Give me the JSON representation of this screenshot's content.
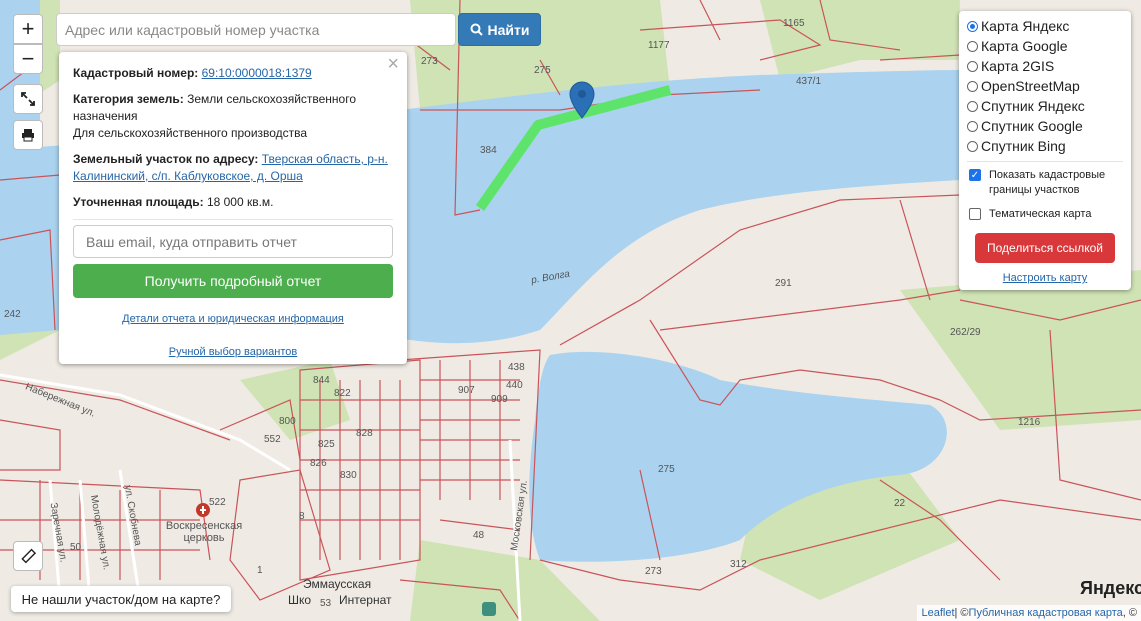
{
  "controls": {
    "zoom_in_label": "+",
    "zoom_out_label": "−",
    "fullscreen_icon": "expand-icon",
    "print_icon": "print-icon",
    "ruler_icon": "ruler-icon"
  },
  "search": {
    "placeholder": "Адрес или кадастровый номер участка",
    "button_label": "Найти"
  },
  "popup": {
    "cadastral_label": "Кадастровый номер:",
    "cadastral_value": "69:10:0000018:1379",
    "category_label": "Категория земель:",
    "category_value": "Земли сельскохозяйственного назначения",
    "usage_value": "Для сельскохозяйственного производства",
    "address_label": "Земельный участок по адресу:",
    "address_value": "Тверская область, р-н. Калининский, с/п. Каблуковское, д. Орша",
    "area_label": "Уточненная площадь:",
    "area_value": "18 000 кв.м.",
    "email_placeholder": "Ваш email, куда отправить отчет",
    "report_button": "Получить подробный отчет",
    "details_link": "Детали отчета и юридическая информация",
    "manual_link": "Ручной выбор вариантов"
  },
  "layers": {
    "options": [
      {
        "label": "Карта Яндекс",
        "selected": true
      },
      {
        "label": "Карта Google",
        "selected": false
      },
      {
        "label": "Карта 2GIS",
        "selected": false
      },
      {
        "label": "OpenStreetMap",
        "selected": false
      },
      {
        "label": "Спутник Яндекс",
        "selected": false
      },
      {
        "label": "Спутник Google",
        "selected": false
      },
      {
        "label": "Спутник Bing",
        "selected": false
      }
    ],
    "show_boundaries_label": "Показать кадастровые границы участков",
    "show_boundaries_checked": true,
    "thematic_label": "Тематическая карта",
    "thematic_checked": false,
    "share_button": "Поделиться ссылкой",
    "tune_link": "Настроить карту"
  },
  "not_found_button": "Не нашли участок/дом на карте?",
  "attribution": {
    "leaflet": "Leaflet",
    "sep": " | © ",
    "pkk": "Публичная кадастровая карта",
    "tail": ", ©"
  },
  "yandex_logo": "Яндекс",
  "map_labels": {
    "river": "р. Волга",
    "n1165": "1165",
    "n1177": "1177",
    "n273a": "273",
    "n275a": "275",
    "n437": "437/1",
    "n384": "384",
    "n242": "242",
    "n291": "291",
    "n262": "262/29",
    "n1216": "1216",
    "n275b": "275",
    "n22": "22",
    "n312": "312",
    "n273b": "273",
    "n438": "438",
    "n440": "440",
    "n907": "907",
    "n909": "909",
    "n844": "844",
    "n822": "822",
    "n800": "800",
    "n552": "552",
    "n825": "825",
    "n826": "826",
    "n828": "828",
    "n830": "830",
    "n8": "8",
    "n48": "48",
    "n1": "1",
    "n522": "522",
    "n50": "50",
    "n53": "53",
    "church": "Воскресенская церковь",
    "emmaus": "Эммаусская",
    "school": "Шко",
    "internat": "Интернат",
    "street_nab": "Набережная ул.",
    "street_mosk": "Московская ул.",
    "street_skob": "ул. Скобнева",
    "street_molod": "Молодёжная ул.",
    "street_zarech": "Заречная ул."
  }
}
